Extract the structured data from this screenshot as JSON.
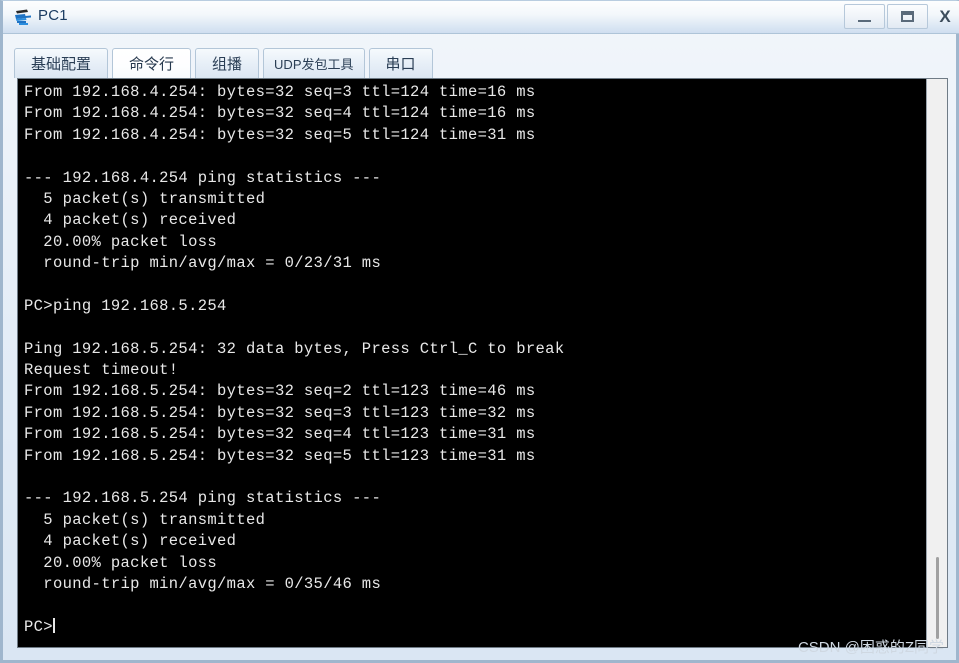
{
  "window": {
    "title": "PC1",
    "icon": "pc-device-icon",
    "controls": {
      "minimize": "—",
      "maximize": "❐",
      "close": "X"
    }
  },
  "tabs": [
    {
      "label": "基础配置",
      "active": false,
      "small": false
    },
    {
      "label": "命令行",
      "active": true,
      "small": false
    },
    {
      "label": "组播",
      "active": false,
      "small": false
    },
    {
      "label": "UDP发包工具",
      "active": false,
      "small": true
    },
    {
      "label": "串口",
      "active": false,
      "small": false
    }
  ],
  "terminal": {
    "prompt": "PC>",
    "cursor_visible": true,
    "lines": [
      "From 192.168.4.254: bytes=32 seq=3 ttl=124 time=16 ms",
      "From 192.168.4.254: bytes=32 seq=4 ttl=124 time=16 ms",
      "From 192.168.4.254: bytes=32 seq=5 ttl=124 time=31 ms",
      "",
      "--- 192.168.4.254 ping statistics ---",
      "  5 packet(s) transmitted",
      "  4 packet(s) received",
      "  20.00% packet loss",
      "  round-trip min/avg/max = 0/23/31 ms",
      "",
      "PC>ping 192.168.5.254",
      "",
      "Ping 192.168.5.254: 32 data bytes, Press Ctrl_C to break",
      "Request timeout!",
      "From 192.168.5.254: bytes=32 seq=2 ttl=123 time=46 ms",
      "From 192.168.5.254: bytes=32 seq=3 ttl=123 time=32 ms",
      "From 192.168.5.254: bytes=32 seq=4 ttl=123 time=31 ms",
      "From 192.168.5.254: bytes=32 seq=5 ttl=123 time=31 ms",
      "",
      "--- 192.168.5.254 ping statistics ---",
      "  5 packet(s) transmitted",
      "  4 packet(s) received",
      "  20.00% packet loss",
      "  round-trip min/avg/max = 0/35/46 ms",
      ""
    ]
  },
  "scrollbar": {
    "orientation": "vertical",
    "thumb_position_pct": 84
  },
  "watermark": {
    "text": "CSDN @困惑的Z同学"
  },
  "colors": {
    "terminal_bg": "#000000",
    "terminal_fg": "#e8e8e8",
    "title_accent": "#1b3c62",
    "frame": "#9fb6cd"
  }
}
